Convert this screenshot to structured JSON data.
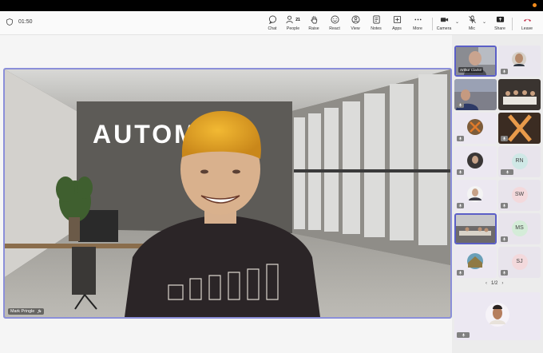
{
  "meeting": {
    "timer": "01:50"
  },
  "toolbar": {
    "chat": "Chat",
    "people": "People",
    "people_count": "21",
    "raise": "Raise",
    "react": "React",
    "view": "View",
    "notes": "Notes",
    "apps": "Apps",
    "more": "More",
    "camera": "Camera",
    "mic": "Mic",
    "share": "Share",
    "leave": "Leave"
  },
  "stage": {
    "speaker": "Mark Pringle",
    "wall_text": "AUTOMO  X"
  },
  "sidebar": {
    "tiles": [
      {
        "type": "video",
        "name": "Arthur Clarke"
      },
      {
        "type": "video"
      },
      {
        "type": "video"
      },
      {
        "type": "video"
      },
      {
        "type": "video"
      },
      {
        "type": "video"
      },
      {
        "type": "video"
      },
      {
        "type": "initials",
        "initials": "RN"
      },
      {
        "type": "video"
      },
      {
        "type": "initials",
        "initials": "SW"
      },
      {
        "type": "video"
      },
      {
        "type": "initials",
        "initials": "MS"
      },
      {
        "type": "video"
      },
      {
        "type": "initials",
        "initials": "SJ"
      }
    ],
    "page": "1/2"
  },
  "colors": {
    "accent": "#5b5fc7",
    "leave": "#c4314b",
    "notify": "#f28b1c"
  }
}
